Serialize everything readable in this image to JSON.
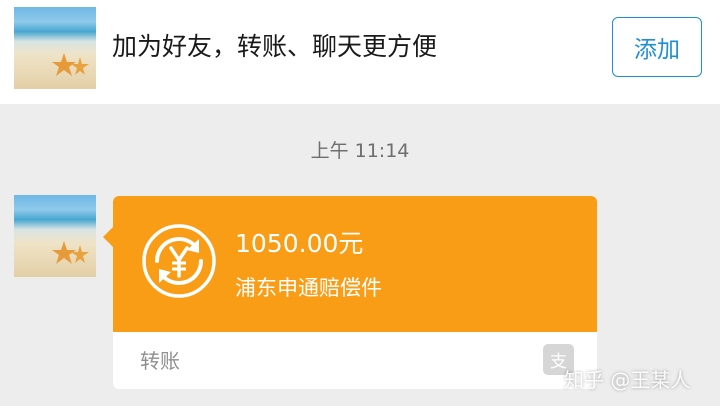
{
  "banner": {
    "text": "加为好友，转账、聊天更方便",
    "add_button": "添加"
  },
  "chat": {
    "timestamp": "上午 11:14",
    "message": {
      "type": "transfer",
      "amount": "1050.00元",
      "memo": "浦东申通赔偿件",
      "footer_label": "转账",
      "brand_icon": "支",
      "bubble_color": "#fa9d16"
    }
  },
  "watermark": "知乎 @王某人",
  "colors": {
    "accent": "#1e8fd6",
    "bubble": "#fa9d16",
    "background": "#ededed"
  }
}
